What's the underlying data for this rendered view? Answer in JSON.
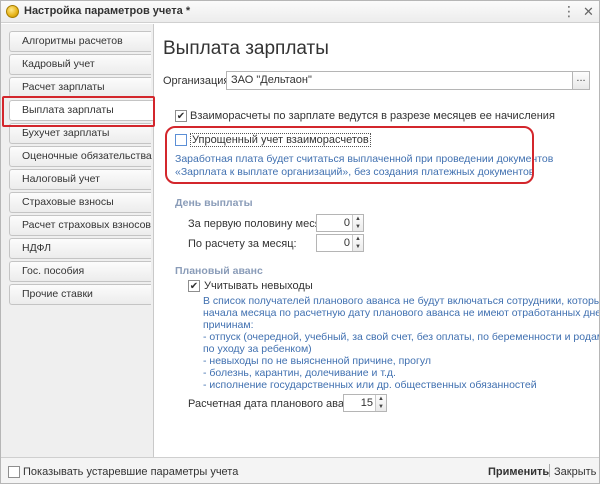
{
  "window": {
    "title": "Настройка параметров учета *",
    "more_glyph": "⋮",
    "close_glyph": "✕"
  },
  "nav": {
    "items": [
      {
        "label": "Алгоритмы расчетов"
      },
      {
        "label": "Кадровый учет"
      },
      {
        "label": "Расчет зарплаты"
      },
      {
        "label": "Выплата зарплаты"
      },
      {
        "label": "Бухучет зарплаты"
      },
      {
        "label": "Оценочные обязательства"
      },
      {
        "label": "Налоговый учет"
      },
      {
        "label": "Страховые взносы"
      },
      {
        "label": "Расчет страховых взносов"
      },
      {
        "label": "НДФЛ"
      },
      {
        "label": "Гос. пособия"
      },
      {
        "label": "Прочие ставки"
      }
    ],
    "active_index": 3
  },
  "main": {
    "title": "Выплата зарплаты",
    "org_label": "Организация:",
    "org_value": "ЗАО \"Дельтаон\"",
    "org_select_glyph": "...",
    "mutual_by_month": {
      "label": "Взаиморасчеты по зарплате ведутся в разрезе месяцев ее начисления",
      "checked": true
    },
    "simplified": {
      "label": "Упрощенный учет взаиморасчетов",
      "checked": false
    },
    "simplified_hint_1": "Заработная плата будет считаться выплаченной при проведении документов",
    "simplified_hint_2": "«Зарплата к выплате организаций», без создания платежных документов",
    "payday_header": "День выплаты",
    "first_half_label": "За первую половину месяца:",
    "first_half_value": "0",
    "month_label": "По расчету за месяц:",
    "month_value": "0",
    "advance_header": "Плановый аванс",
    "absences": {
      "label": "Учитывать невыходы",
      "checked": true
    },
    "absence_hint": [
      "В список получателей планового аванса не будут включаться сотрудники, которые с",
      "начала месяца по расчетную дату планового аванса не имеют отработанных дней по",
      "причинам:",
      "- отпуск (очередной, учебный, за свой счет, без оплаты, по беременности и родам,",
      "по уходу за ребенком)",
      "- невыходы по не выясненной причине, прогул",
      "- болезнь, карантин, долечивание и т.д.",
      "- исполнение государственных или др. общественных обязанностей"
    ],
    "advance_date_label": "Расчетная дата планового аванса:",
    "advance_date_value": "15",
    "spin_glyph": "▲\n▼"
  },
  "footer": {
    "show_obsolete": {
      "label": "Показывать устаревшие параметры учета",
      "checked": false
    },
    "apply_label": "Применить",
    "close_label": "Закрыть"
  }
}
